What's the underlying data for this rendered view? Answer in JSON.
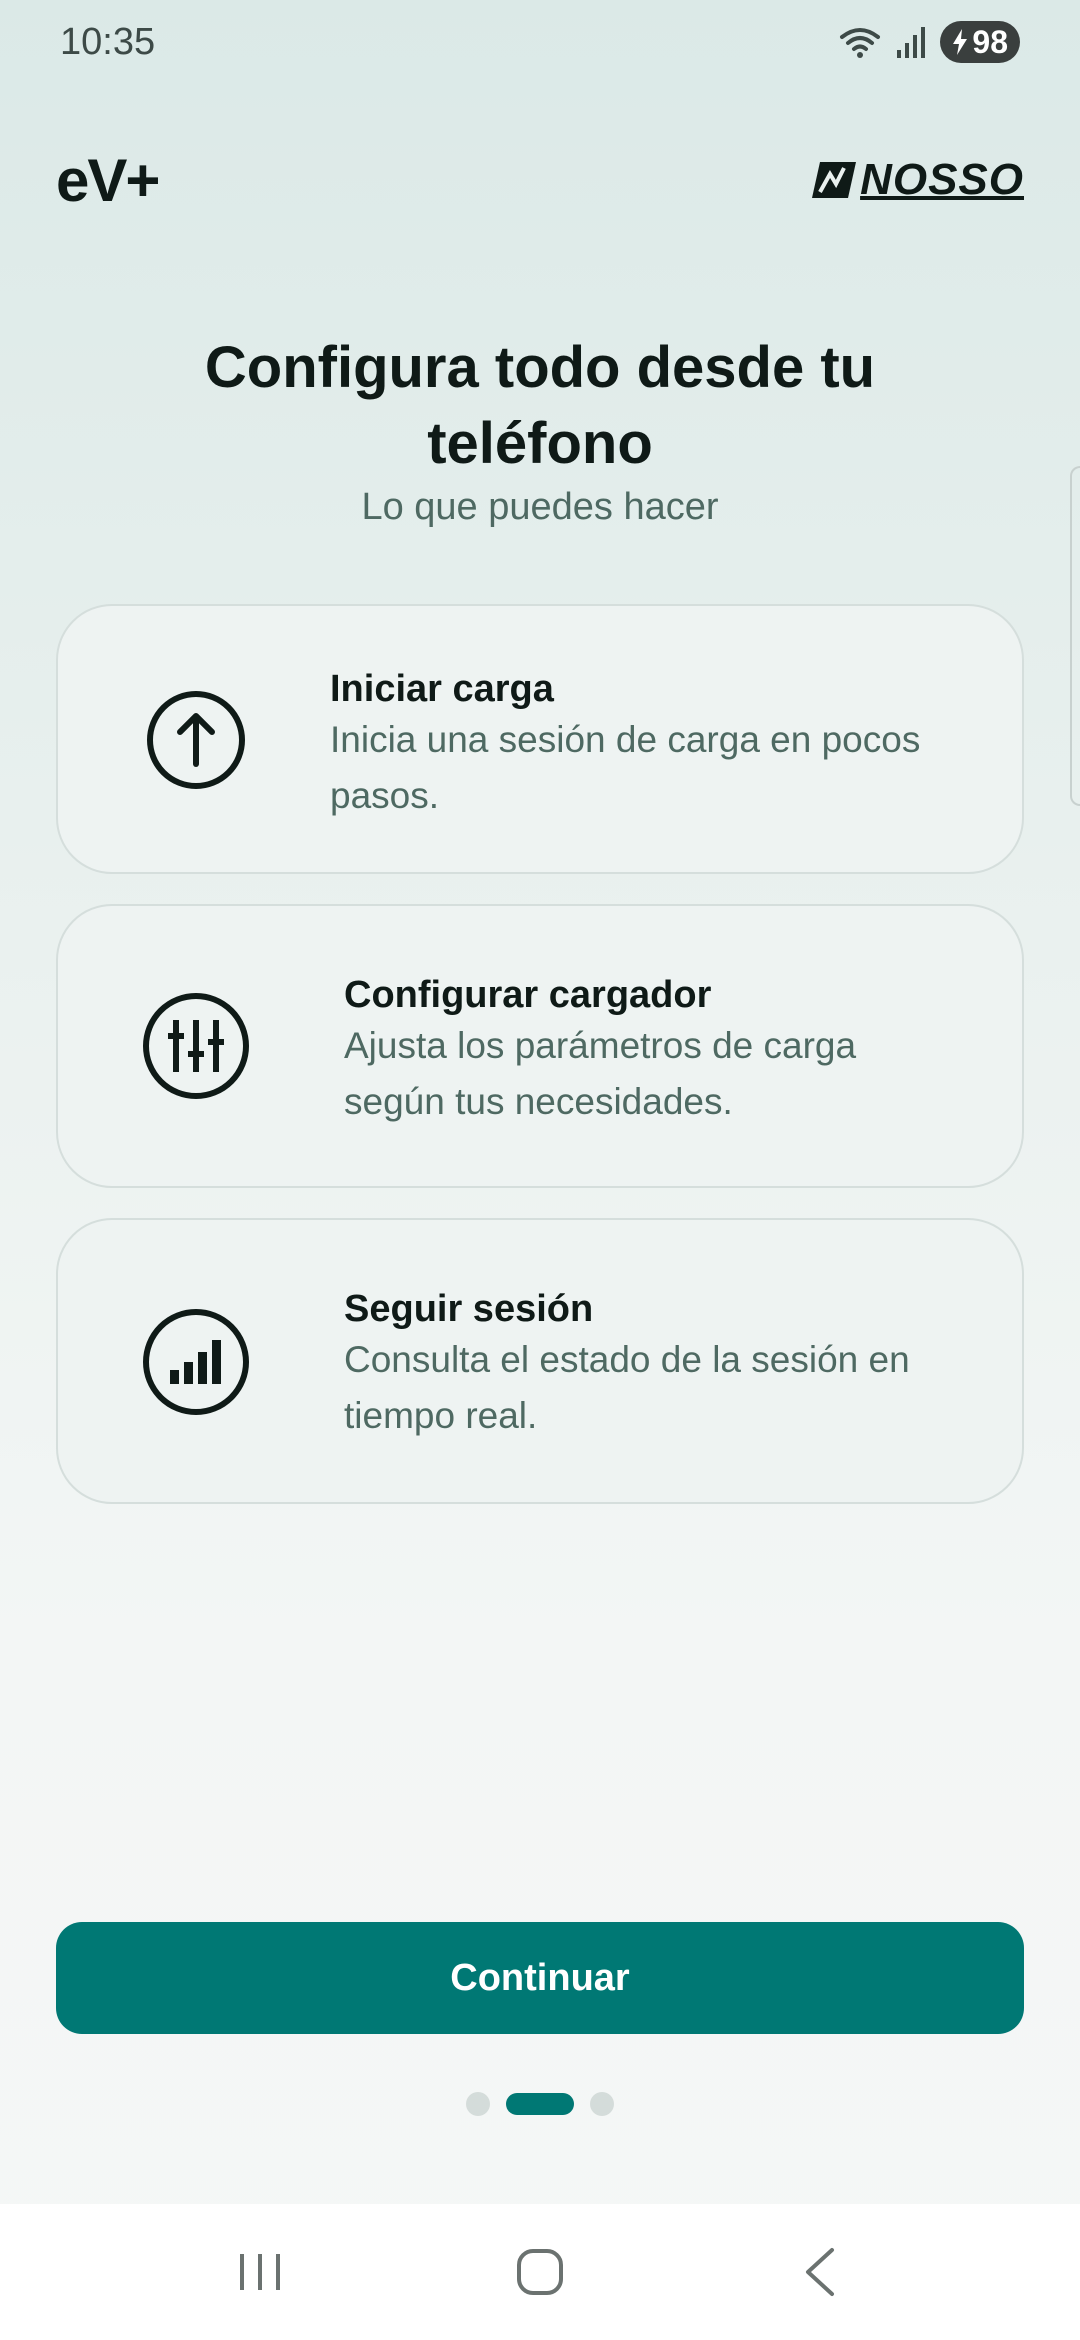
{
  "status_bar": {
    "time": "10:35",
    "battery": "98",
    "icons": [
      "wifi-icon",
      "signal-icon",
      "battery-icon"
    ]
  },
  "header": {
    "app_logo": "eV+",
    "partner_logo": "NOSSO"
  },
  "title": "Configura todo desde tu teléfono",
  "subtitle": "Lo que puedes hacer",
  "features": [
    {
      "icon": "arrow-up-circle-icon",
      "title": "Iniciar carga",
      "description": "Inicia una sesión de carga en pocos pasos."
    },
    {
      "icon": "sliders-circle-icon",
      "title": "Configurar cargador",
      "description": "Ajusta los parámetros de carga según tus necesidades."
    },
    {
      "icon": "bar-chart-circle-icon",
      "title": "Seguir sesión",
      "description": "Consulta el estado de la sesión en tiempo real."
    }
  ],
  "continue_label": "Continuar",
  "pager": {
    "total": 3,
    "active_index": 1
  },
  "colors": {
    "accent": "#007874",
    "text_primary": "#0f1a17",
    "text_secondary": "#4e6962",
    "card_bg": "#eef3f2"
  }
}
